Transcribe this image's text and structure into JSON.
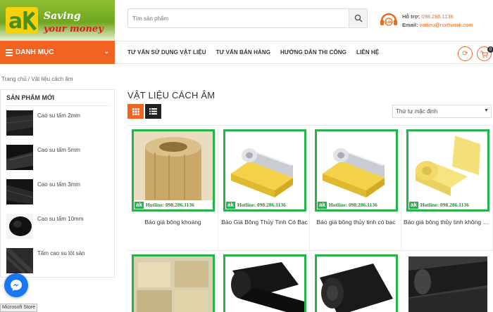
{
  "header": {
    "logo": {
      "mark": "ak",
      "line1": "Saving",
      "line2": "your money"
    },
    "search": {
      "placeholder": "Tìm sản phẩm"
    },
    "support": {
      "hotline_label": "Hỗ trợ:",
      "hotline_value": "098.286.1136",
      "email_label": "Email:",
      "email_value": "vatlieu@noithatak.com"
    }
  },
  "nav": {
    "danh_muc": "DANH MỤC",
    "links": [
      "TƯ VẤN SỬ DỤNG VẬT LIỆU",
      "TƯ VẤN BÁN HÀNG",
      "HƯỚNG DẪN THI CÔNG",
      "LIÊN HỆ"
    ],
    "cart_count": "0"
  },
  "breadcrumb": "Trang chủ / Vật liệu cách âm",
  "sidebar": {
    "title": "SẢN PHẨM MỚI",
    "items": [
      {
        "label": "Cao su tấm 2mm"
      },
      {
        "label": "Cao su tấm 5mm"
      },
      {
        "label": "Cao su tấm 3mm"
      },
      {
        "label": "Cao su tấm 10mm"
      },
      {
        "label": "Tấm cao su lót sàn"
      }
    ]
  },
  "main": {
    "title": "VẬT LIỆU CÁCH ÂM",
    "sort_selected": "Thứ tự mặc định",
    "hotline_stamp": "Hotline: 098.286.1136",
    "stamp_mark": "ak",
    "products": [
      {
        "title": "Báo giá bông khoáng"
      },
      {
        "title": "Báo Giá Bông Thủy Tinh Có Bạc"
      },
      {
        "title": "Báo giá bông thủy tinh có bạc"
      },
      {
        "title": "Báo giá bông thủy tinh không bạc"
      }
    ]
  },
  "floating": {
    "ms_store": "Microsoft Store"
  },
  "colors": {
    "accent": "#f26322",
    "green": "#26b34a",
    "messenger": "#1877f2"
  }
}
